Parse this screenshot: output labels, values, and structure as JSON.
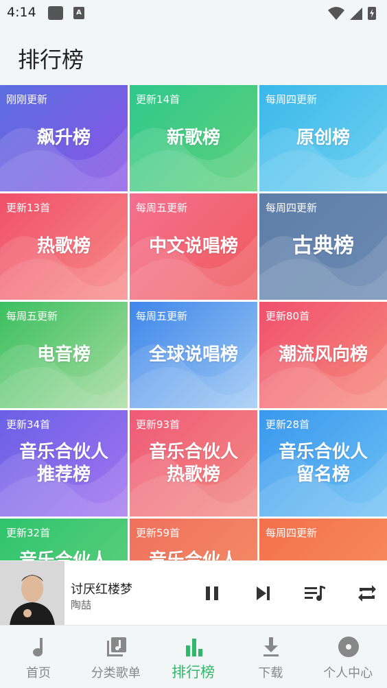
{
  "status_bar": {
    "time": "4:14"
  },
  "header": {
    "title": "排行榜"
  },
  "charts": [
    {
      "sub": "刚刚更新",
      "lines": [
        "飙升榜"
      ],
      "c1": "#5b6ee0",
      "c2": "#8a54e6"
    },
    {
      "sub": "更新14首",
      "lines": [
        "新歌榜"
      ],
      "c1": "#2ec88c",
      "c2": "#5fd07a"
    },
    {
      "sub": "每周四更新",
      "lines": [
        "原创榜"
      ],
      "c1": "#3ab8ea",
      "c2": "#6fd0f2"
    },
    {
      "sub": "更新13首",
      "lines": [
        "热歌榜"
      ],
      "c1": "#f0506a",
      "c2": "#f78a86"
    },
    {
      "sub": "每周五更新",
      "lines": [
        "中文说唱榜"
      ],
      "c1": "#f57090",
      "c2": "#ef5a5a"
    },
    {
      "sub": "每周四更新",
      "lines": [
        "古典榜"
      ],
      "c1": "#5e7ea8",
      "c2": "#6a88b2"
    },
    {
      "sub": "每周五更新",
      "lines": [
        "电音榜"
      ],
      "c1": "#3cc060",
      "c2": "#a8dca0"
    },
    {
      "sub": "每周五更新",
      "lines": [
        "全球说唱榜"
      ],
      "c1": "#3f86ea",
      "c2": "#9cc8f4"
    },
    {
      "sub": "更新80首",
      "lines": [
        "潮流风向榜"
      ],
      "c1": "#f0506e",
      "c2": "#f68a7a"
    },
    {
      "sub": "更新34首",
      "lines": [
        "音乐合伙人",
        "推荐榜"
      ],
      "c1": "#6a60e6",
      "c2": "#a374f0"
    },
    {
      "sub": "更新93首",
      "lines": [
        "音乐合伙人",
        "热歌榜"
      ],
      "c1": "#f05a78",
      "c2": "#f28a82"
    },
    {
      "sub": "更新28首",
      "lines": [
        "音乐合伙人",
        "留名榜"
      ],
      "c1": "#3a98ee",
      "c2": "#6cc0f4"
    },
    {
      "sub": "更新32首",
      "lines": [
        "音乐合伙人",
        ""
      ],
      "c1": "#2ec46c",
      "c2": "#64d07e"
    },
    {
      "sub": "更新59首",
      "lines": [
        "音乐合伙人",
        ""
      ],
      "c1": "#f0705a",
      "c2": "#f4906a"
    },
    {
      "sub": "每周四更新",
      "lines": [
        "",
        ""
      ],
      "c1": "#f3704c",
      "c2": "#f89060"
    }
  ],
  "player": {
    "song": "讨厌红楼梦",
    "artist": "陶喆"
  },
  "nav": [
    {
      "label": "首页",
      "icon": "music-note-icon"
    },
    {
      "label": "分类歌单",
      "icon": "playlist-icon"
    },
    {
      "label": "排行榜",
      "icon": "bar-chart-icon",
      "active": true
    },
    {
      "label": "下载",
      "icon": "download-icon"
    },
    {
      "label": "个人中心",
      "icon": "disc-icon"
    }
  ],
  "colors": {
    "accent": "#2fb86a",
    "inactive": "#888888"
  }
}
